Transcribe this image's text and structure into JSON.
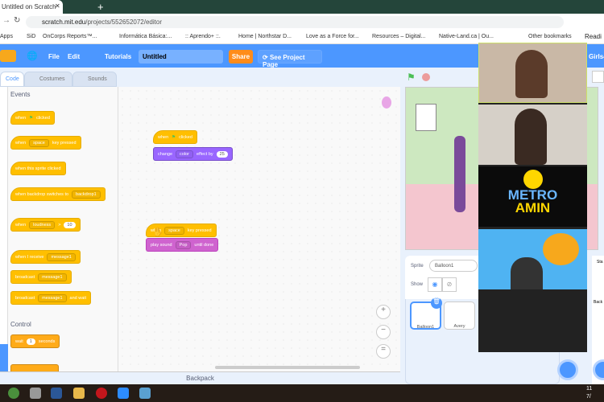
{
  "browser": {
    "tab_title": "Untitled on Scratch",
    "url_host": "scratch.mit.edu",
    "url_path": "/projects/552652072/editor",
    "bookmarks": [
      "Apps",
      "SiD",
      "OnCorps Reports™...",
      "Informática Básica:...",
      ":: Aprendo+ ::.",
      "Home | Northstar D...",
      "Love as a Force for...",
      "Resources – Digital...",
      "Native-Land.ca | Ou...",
      "Other bookmarks",
      "Readi"
    ]
  },
  "menu": {
    "file": "File",
    "edit": "Edit",
    "tutorials": "Tutorials",
    "project_title": "Untitled",
    "share": "Share",
    "see_project": "See Project Page",
    "user": "Girls4"
  },
  "editor_tabs": [
    "Code",
    "Costumes",
    "Sounds"
  ],
  "palette": {
    "events_heading": "Events",
    "control_heading": "Control",
    "when_flag": [
      "when",
      "clicked"
    ],
    "when_key": [
      "when",
      "space",
      "key pressed"
    ],
    "when_sprite": "when this sprite clicked",
    "when_backdrop": [
      "when backdrop switches to",
      "backdrop1"
    ],
    "when_loudness": [
      "when",
      "loudness",
      ">",
      "10"
    ],
    "when_receive": [
      "when I receive",
      "message1"
    ],
    "broadcast": [
      "broadcast",
      "message1"
    ],
    "broadcast_wait": [
      "broadcast",
      "message1",
      "and wait"
    ],
    "wait": [
      "wait",
      "1",
      "seconds"
    ]
  },
  "scripts": {
    "s1_hat": [
      "when",
      "clicked"
    ],
    "s1_block": [
      "change",
      "color",
      "effect by",
      "25"
    ],
    "s2_hat": [
      "when",
      "space",
      "key pressed"
    ],
    "s2_block": [
      "play sound",
      "Pop",
      "until done"
    ]
  },
  "backpack": "Backpack",
  "sprite_pane": {
    "sprite_label": "Sprite",
    "sprite_name": "Balloon1",
    "show_label": "Show",
    "sprites": [
      "Balloon1",
      "Avery"
    ],
    "stage_label": "Sta",
    "backdrop_label": "Back"
  },
  "zoom_tiles": {
    "metro_line1": "METRO",
    "metro_line2": "AMIN"
  },
  "taskbar": {
    "time": "11",
    "date": "7/"
  },
  "colors": {
    "scratch_blue": "#4c97ff",
    "events": "#ffbf00",
    "looks": "#9966ff",
    "sound": "#cf63cf",
    "control": "#ffab19"
  }
}
